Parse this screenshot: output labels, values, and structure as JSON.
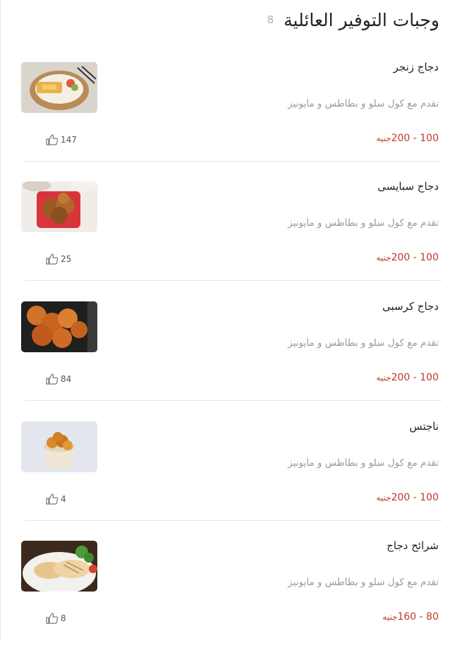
{
  "section": {
    "title": "وجبات التوفير العائلية",
    "count": "8"
  },
  "items": [
    {
      "name": "دجاج زنجر",
      "description": "تقدم مع كول سلو و بطاطس و مايونيز",
      "price_range": "100 - 200",
      "currency": "جنيه",
      "likes": "147"
    },
    {
      "name": "دجاج سبايسى",
      "description": "تقدم مع كول سلو و بطاطس و مايونيز",
      "price_range": "100 - 200",
      "currency": "جنيه",
      "likes": "25"
    },
    {
      "name": "دجاج كرسبى",
      "description": "تقدم مع كول سلو و بطاطس و مايونيز",
      "price_range": "100 - 200",
      "currency": "جنيه",
      "likes": "84"
    },
    {
      "name": "ناجتس",
      "description": "تقدم مع كول سلو و بطاطس و مايونيز",
      "price_range": "100 - 200",
      "currency": "جنيه",
      "likes": "4"
    },
    {
      "name": "شرائح دجاج",
      "description": "تقدم مع كول سلو و بطاطس و مايونيز",
      "price_range": "80 - 160",
      "currency": "جنيه",
      "likes": "8"
    }
  ],
  "icons": {
    "like": "thumbs-up-icon"
  },
  "colors": {
    "price": "#c0392b",
    "muted": "#9a9a9a",
    "text": "#222222"
  }
}
